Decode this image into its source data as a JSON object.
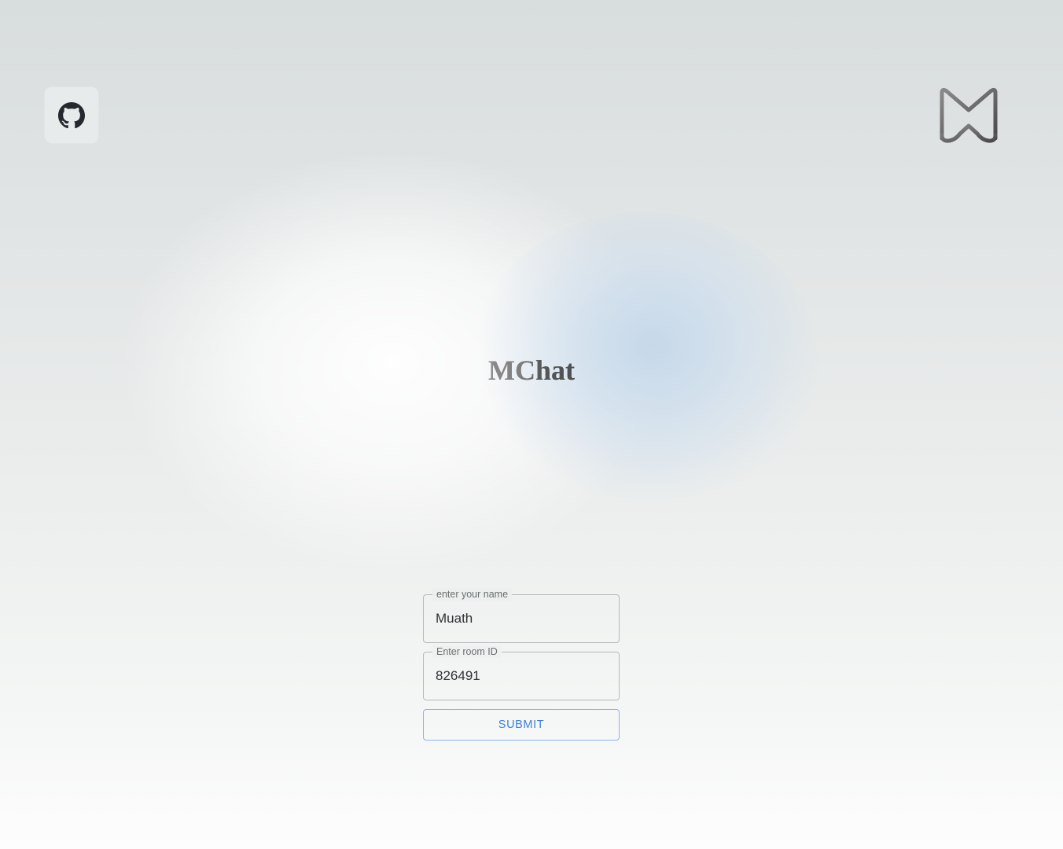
{
  "app": {
    "title": "MChat"
  },
  "header": {
    "github_icon": "github-icon",
    "logo_icon": "mchat-logo"
  },
  "form": {
    "name_field": {
      "label": "enter your name",
      "value": "Muath"
    },
    "room_field": {
      "label": "Enter room ID",
      "value": "826491"
    },
    "submit_label": "SUBMIT"
  },
  "colors": {
    "accent": "#3d7fd6",
    "submit_border": "#8db2e4",
    "title_gray": "#6a6a6a",
    "github_bg": "#e8ebec"
  }
}
